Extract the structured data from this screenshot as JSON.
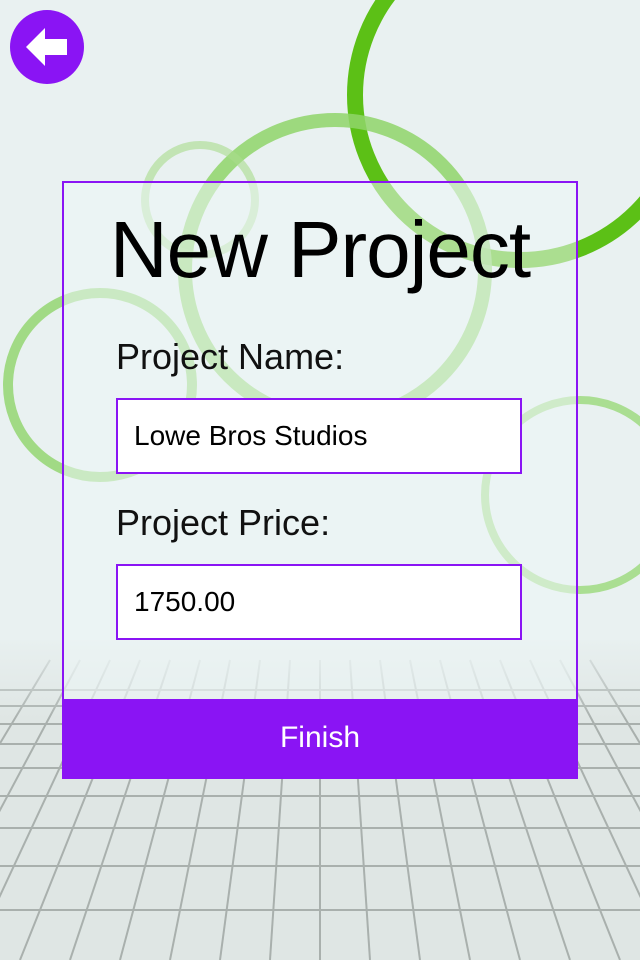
{
  "colors": {
    "accent": "#8a14f4",
    "ring_green": "#5cc016",
    "background": "#e9f1f1"
  },
  "header": {
    "back_icon": "arrow-left-icon"
  },
  "form": {
    "title": "New Project",
    "project_name_label": "Project Name:",
    "project_name_value": "Lowe Bros Studios",
    "project_price_label": "Project Price:",
    "project_price_value": "1750.00",
    "finish_label": "Finish"
  }
}
